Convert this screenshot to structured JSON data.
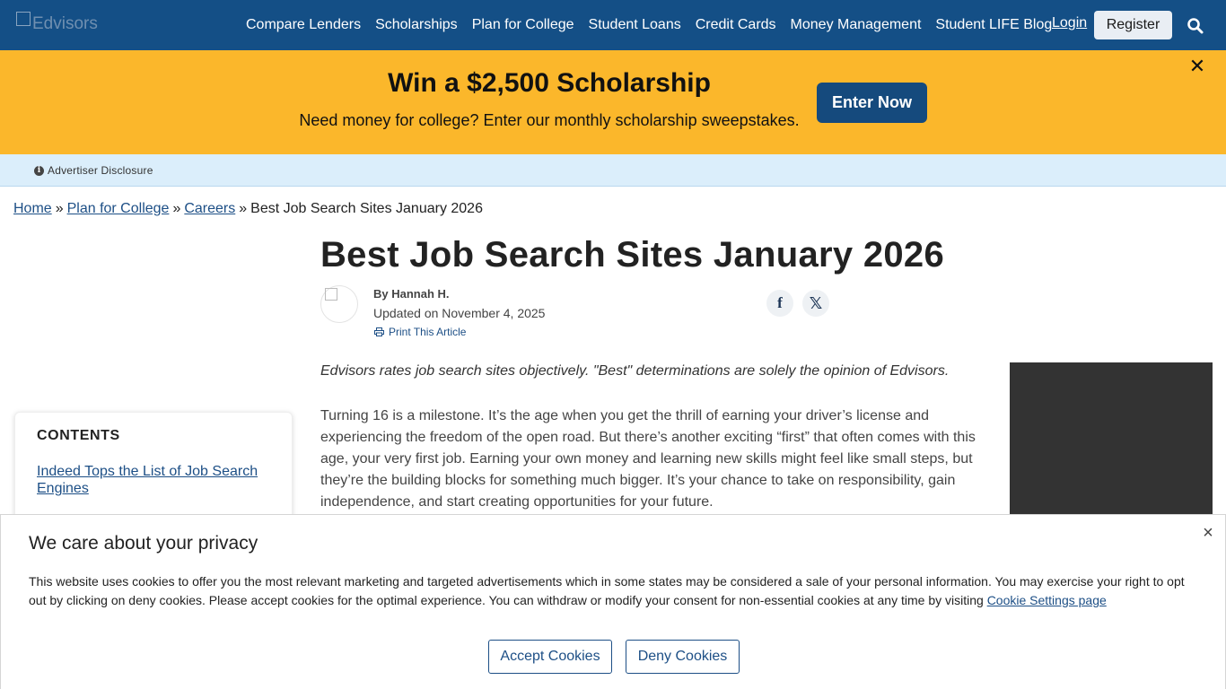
{
  "header": {
    "logo_alt": "Edvisors",
    "nav": [
      {
        "label": "Compare Lenders"
      },
      {
        "label": "Scholarships"
      },
      {
        "label": "Plan for College"
      },
      {
        "label": "Student Loans"
      },
      {
        "label": "Credit Cards"
      },
      {
        "label": "Money Management"
      },
      {
        "label": "Student LIFE Blog"
      }
    ],
    "login_label": "Login",
    "register_label": "Register",
    "search_icon": "search-icon"
  },
  "promo": {
    "title": "Win a $2,500 Scholarship",
    "subtitle": "Need money for college? Enter our monthly scholarship sweepstakes.",
    "cta_label": "Enter Now",
    "close_glyph": "✕"
  },
  "disclosure": {
    "label": "Advertiser Disclosure",
    "icon_glyph": "i"
  },
  "breadcrumb": {
    "items": [
      "Home",
      "Plan for College",
      "Careers"
    ],
    "current": "Best Job Search Sites January 2026",
    "separator": "»"
  },
  "article": {
    "title": "Best Job Search Sites January 2026",
    "byline": "By Hannah H.",
    "updated": "Updated on November 4, 2025",
    "print_label": "Print This Article",
    "share_facebook": "f",
    "share_x": "𝕏",
    "disclaimer": "Edvisors rates job search sites objectively. \"Best\" determinations are solely the opinion of Edvisors.",
    "intro": "Turning 16 is a milestone. It’s the age when you get the thrill of earning your driver’s license and experiencing the freedom of the open road. But there’s another exciting “first” that often comes with this age, your very first job. Earning your own money and learning new skills might feel like small steps, but they’re the building blocks for something much bigger. It’s your chance to take on responsibility, gain independence, and start creating opportunities for your future."
  },
  "toc": {
    "title": "CONTENTS",
    "items": [
      "Indeed Tops the List of Job Search Engines"
    ]
  },
  "cookie": {
    "title": "We care about your privacy",
    "text": "This website uses cookies to offer you the most relevant marketing and targeted advertisements which in some states may be considered a sale of your personal information. You may exercise your right to opt out by clicking on deny cookies. Please accept cookies for the optimal experience. You can withdraw or modify your consent for non-essential cookies at any time by visiting ",
    "link_label": "Cookie Settings page",
    "accept_label": "Accept Cookies",
    "deny_label": "Deny Cookies",
    "close_glyph": "×"
  },
  "colors": {
    "header_bg": "#144f86",
    "promo_bg": "#fbb72b",
    "cta_bg": "#154a7d",
    "disclosure_bg": "#dbeefb",
    "link": "#1d4f86",
    "ad_bg": "#333333"
  }
}
